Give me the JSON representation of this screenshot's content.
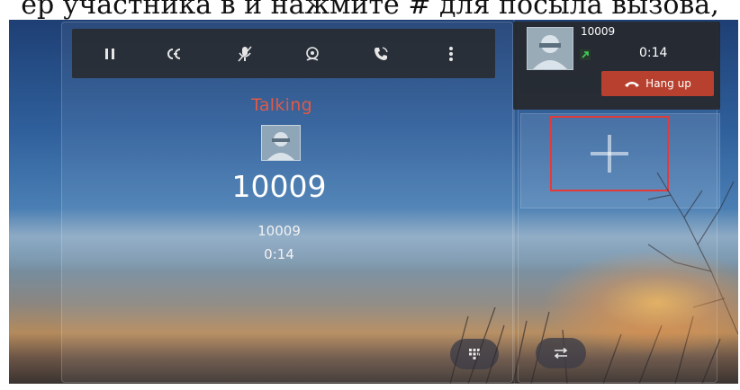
{
  "caption": {
    "text": "ер участника в и нажмите # для посыла вызова,"
  },
  "toolbar": {
    "buttons": [
      {
        "name": "hold",
        "icon": "pause-icon"
      },
      {
        "name": "transfer",
        "icon": "transfer-icon"
      },
      {
        "name": "mute",
        "icon": "mic-mute-icon"
      },
      {
        "name": "record",
        "icon": "record-icon"
      },
      {
        "name": "handset",
        "icon": "handset-icon"
      },
      {
        "name": "more",
        "icon": "more-vertical-icon"
      }
    ]
  },
  "call": {
    "status": "Talking",
    "status_color": "#e05a46",
    "display_name": "10009",
    "number": "10009",
    "duration": "0:14"
  },
  "side_card": {
    "number": "10009",
    "duration": "0:14",
    "hangup_label": "Hang up",
    "hangup_color": "#b8402e"
  },
  "add_participant": {
    "icon": "plus-icon",
    "highlight_color": "#e53a3a"
  },
  "bottom": {
    "dialpad_icon": "dialpad-icon",
    "swap_icon": "swap-icon"
  }
}
